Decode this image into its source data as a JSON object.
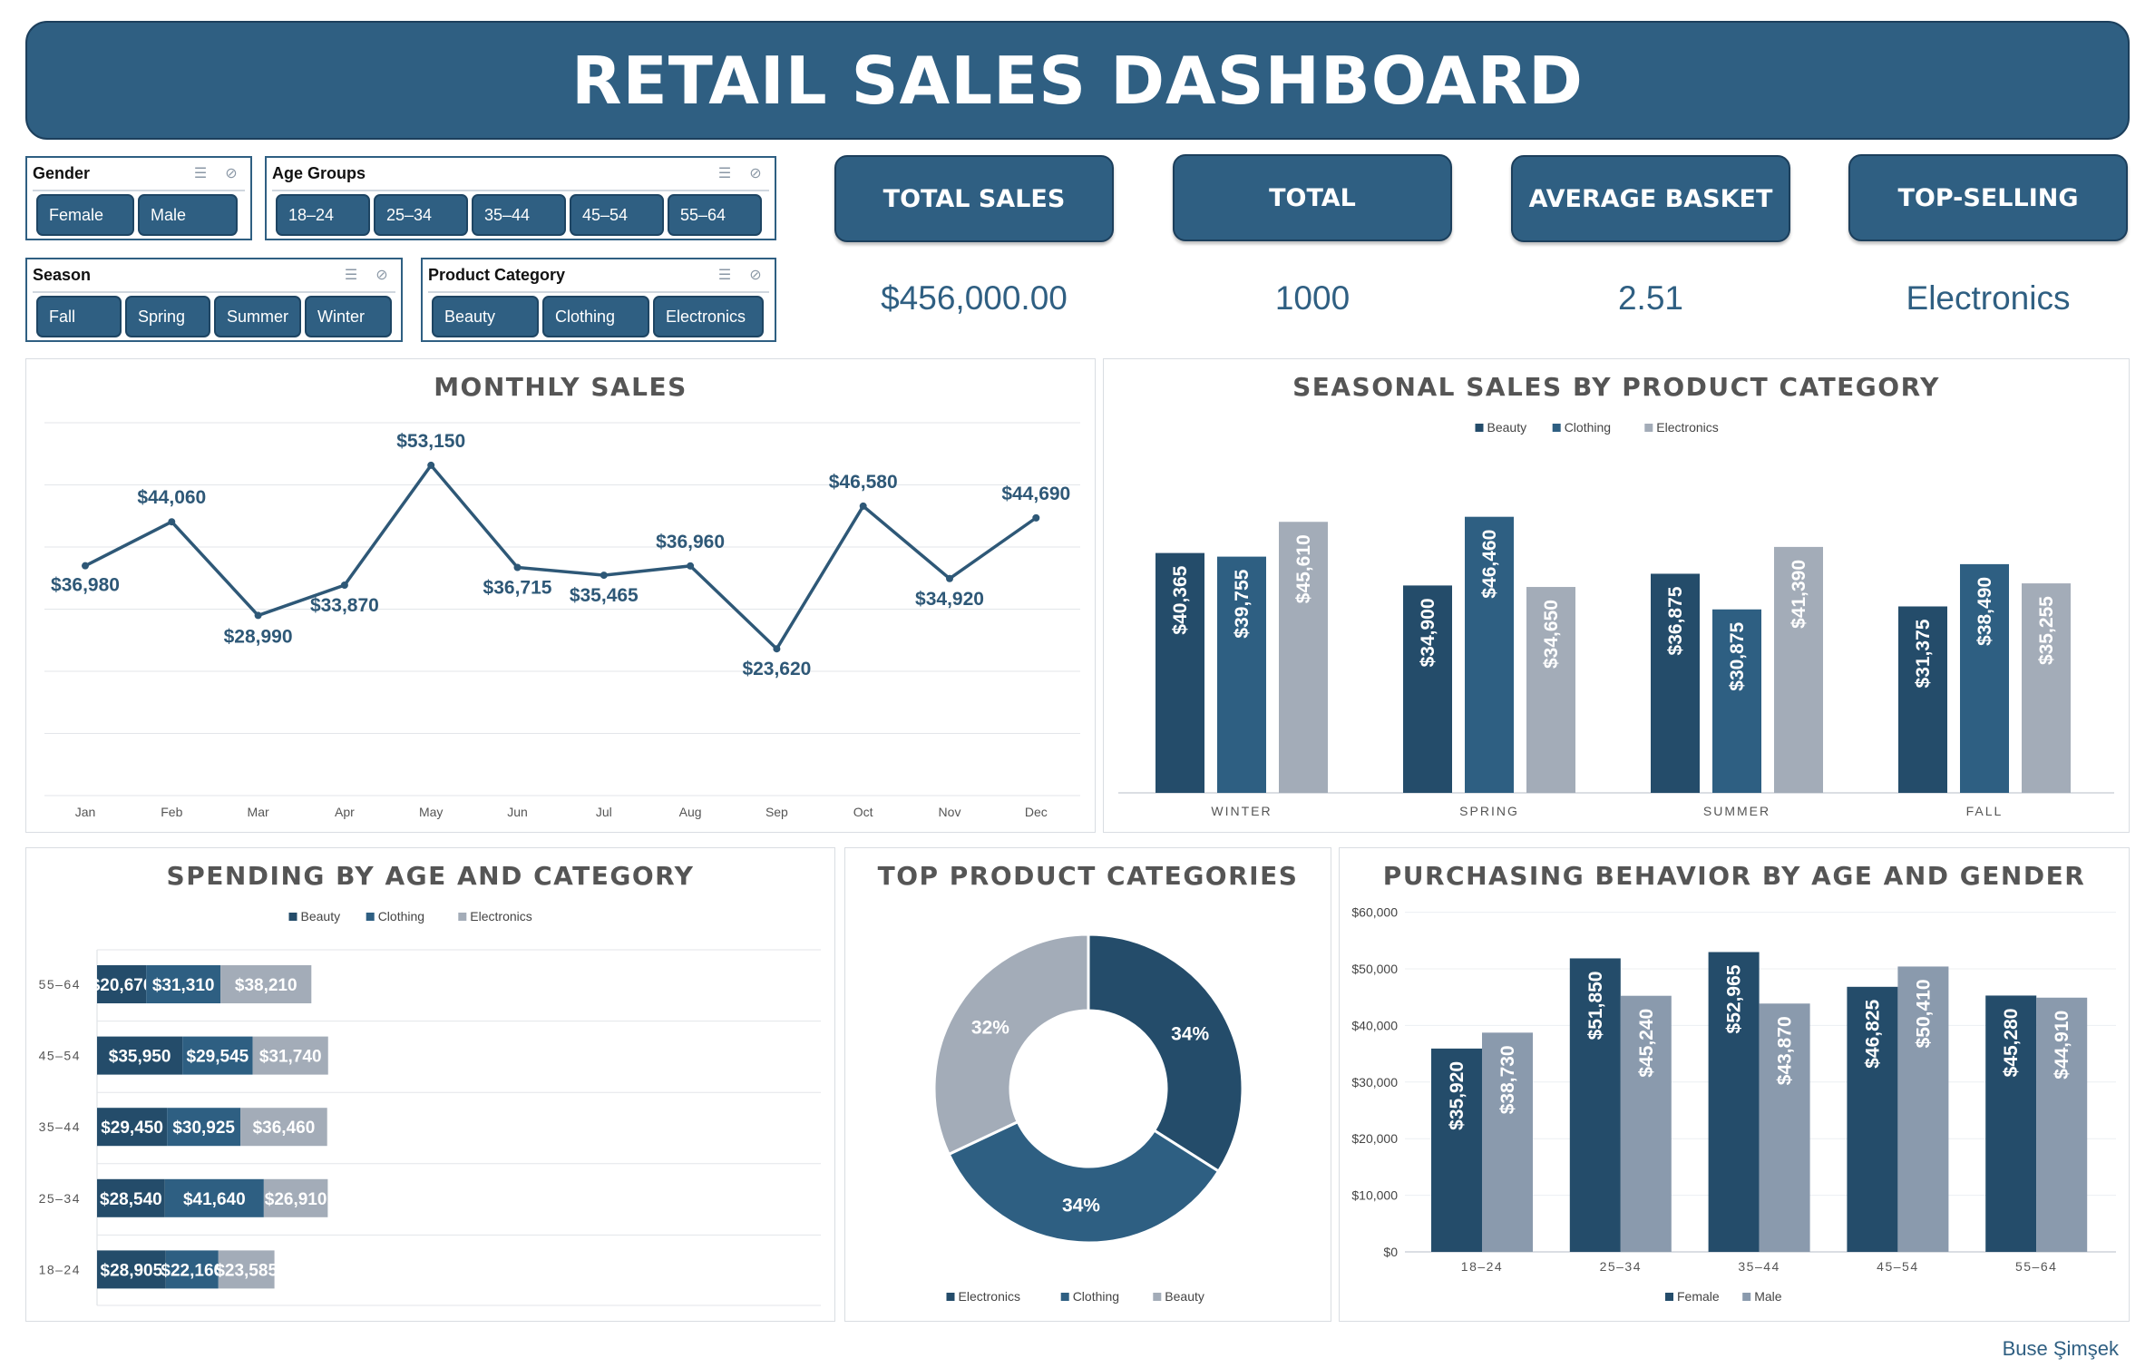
{
  "title": "RETAIL SALES DASHBOARD",
  "colors": {
    "dark": "#244c6a",
    "mid": "#2e5f82",
    "light": "#a3acb8",
    "male": "#8a9aad",
    "line": "#2e5877"
  },
  "slicers": {
    "gender": {
      "title": "Gender",
      "items": [
        "Female",
        "Male"
      ]
    },
    "age": {
      "title": "Age Groups",
      "items": [
        "18–24",
        "25–34",
        "35–44",
        "45–54",
        "55–64"
      ]
    },
    "season": {
      "title": "Season",
      "items": [
        "Fall",
        "Spring",
        "Summer",
        "Winter"
      ]
    },
    "category": {
      "title": "Product Category",
      "items": [
        "Beauty",
        "Clothing",
        "Electronics"
      ]
    }
  },
  "kpis": [
    {
      "label": "TOTAL SALES",
      "value": "$456,000.00"
    },
    {
      "label": "TOTAL",
      "value": "1000"
    },
    {
      "label": "AVERAGE BASKET",
      "value": "2.51"
    },
    {
      "label": "TOP-SELLING",
      "value": "Electronics"
    }
  ],
  "panels": {
    "monthly": "MONTHLY SALES",
    "seasonal": "SEASONAL SALES BY PRODUCT CATEGORY",
    "spending": "SPENDING BY AGE AND CATEGORY",
    "top": "TOP PRODUCT CATEGORIES",
    "behavior": "PURCHASING BEHAVIOR BY AGE AND GENDER"
  },
  "footer": "Buse Şimşek",
  "chart_data": [
    {
      "id": "monthly",
      "type": "line",
      "title": "MONTHLY SALES",
      "categories": [
        "Jan",
        "Feb",
        "Mar",
        "Apr",
        "May",
        "Jun",
        "Jul",
        "Aug",
        "Sep",
        "Oct",
        "Nov",
        "Dec"
      ],
      "values": [
        36980,
        44060,
        28990,
        33870,
        53150,
        36715,
        35465,
        36960,
        23620,
        46580,
        34920,
        44690
      ],
      "labels": [
        "$36,980",
        "$44,060",
        "$28,990",
        "$33,870",
        "$53,150",
        "$36,715",
        "$35,465",
        "$36,960",
        "$23,620",
        "$46,580",
        "$34,920",
        "$44,690"
      ],
      "ylim": [
        0,
        60000
      ],
      "grid": true
    },
    {
      "id": "seasonal",
      "type": "bar",
      "title": "SEASONAL SALES BY PRODUCT CATEGORY",
      "categories": [
        "WINTER",
        "SPRING",
        "SUMMER",
        "FALL"
      ],
      "series": [
        {
          "name": "Beauty",
          "values": [
            40365,
            34900,
            36875,
            31375
          ],
          "labels": [
            "$40,365",
            "$34,900",
            "$36,875",
            "$31,375"
          ]
        },
        {
          "name": "Clothing",
          "values": [
            39755,
            46460,
            30875,
            38490
          ],
          "labels": [
            "$39,755",
            "$46,460",
            "$30,875",
            "$38,490"
          ]
        },
        {
          "name": "Electronics",
          "values": [
            45610,
            34650,
            41390,
            35255
          ],
          "labels": [
            "$45,610",
            "$34,650",
            "$41,390",
            "$35,255"
          ]
        }
      ],
      "ylim": [
        0,
        52000
      ],
      "legend": "top"
    },
    {
      "id": "spending",
      "type": "bar",
      "title": "SPENDING BY AGE AND CATEGORY",
      "categories": [
        "55–64",
        "45–54",
        "35–44",
        "25–34",
        "18–24"
      ],
      "series": [
        {
          "name": "Beauty",
          "values": [
            20670,
            35950,
            29450,
            28540,
            28905
          ],
          "labels": [
            "$20,670",
            "$35,950",
            "$29,450",
            "$28,540",
            "$28,905"
          ]
        },
        {
          "name": "Clothing",
          "values": [
            31310,
            29545,
            30925,
            41640,
            22160
          ],
          "labels": [
            "$31,310",
            "$29,545",
            "$30,925",
            "$41,640",
            "$22,160"
          ]
        },
        {
          "name": "Electronics",
          "values": [
            38210,
            31740,
            36460,
            26910,
            23585
          ],
          "labels": [
            "$38,210",
            "$31,740",
            "$36,460",
            "$26,910",
            "$23,585"
          ]
        }
      ],
      "stacked": true,
      "orientation": "horizontal",
      "legend": "top"
    },
    {
      "id": "top",
      "type": "pie",
      "title": "TOP PRODUCT CATEGORIES",
      "categories": [
        "Electronics",
        "Clothing",
        "Beauty"
      ],
      "values": [
        34,
        34,
        32
      ],
      "labels": [
        "34%",
        "34%",
        "32%"
      ],
      "donut": true,
      "legend": "bottom"
    },
    {
      "id": "behavior",
      "type": "bar",
      "title": "PURCHASING BEHAVIOR BY AGE AND GENDER",
      "categories": [
        "18–24",
        "25–34",
        "35–44",
        "45–54",
        "55–64"
      ],
      "series": [
        {
          "name": "Female",
          "values": [
            35920,
            51850,
            52965,
            46825,
            45280
          ],
          "labels": [
            "$35,920",
            "$51,850",
            "$52,965",
            "$46,825",
            "$45,280"
          ]
        },
        {
          "name": "Male",
          "values": [
            38730,
            45240,
            43870,
            50410,
            44910
          ],
          "labels": [
            "$38,730",
            "$45,240",
            "$43,870",
            "$50,410",
            "$44,910"
          ]
        }
      ],
      "yticks": [
        "$0",
        "$10,000",
        "$20,000",
        "$30,000",
        "$40,000",
        "$50,000",
        "$60,000"
      ],
      "ylim": [
        0,
        60000
      ],
      "legend": "bottom"
    }
  ]
}
